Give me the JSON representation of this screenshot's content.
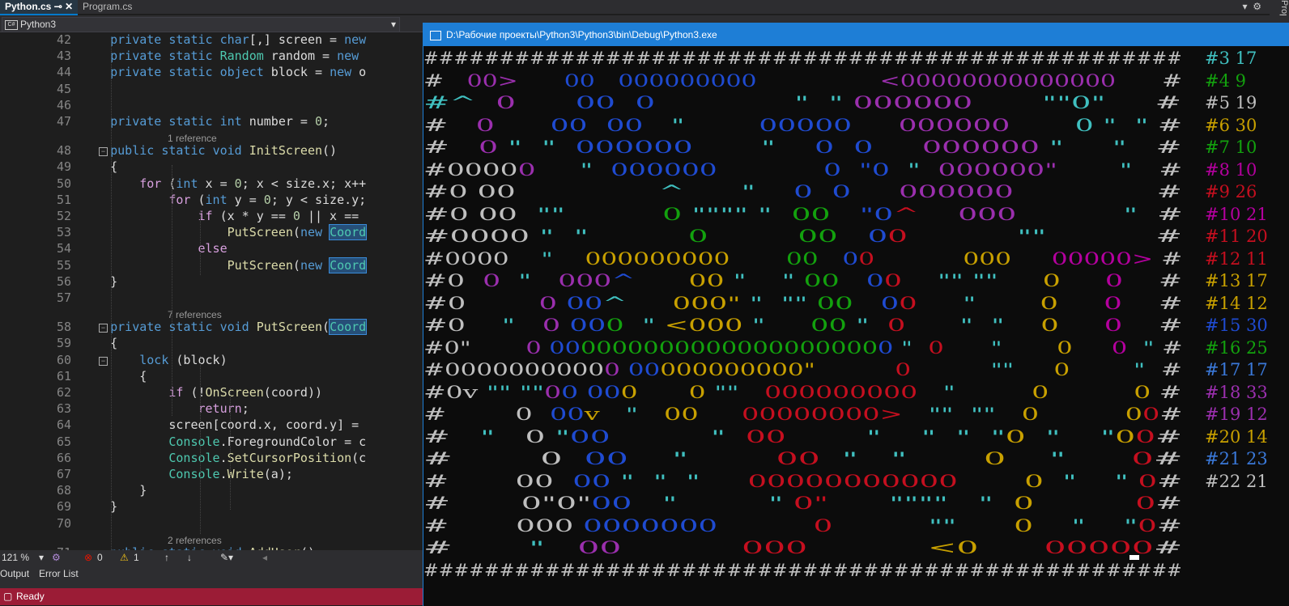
{
  "tabs": [
    {
      "label": "Python.cs",
      "active": true
    },
    {
      "label": "Program.cs",
      "active": false
    }
  ],
  "nav_combo": {
    "icon": "C#",
    "label": "Python3"
  },
  "side_panel": {
    "label": "Prope"
  },
  "editor_lines": [
    {
      "num": "42",
      "html": "    <span class=\"kw\">private static</span> <span class=\"kw\">char</span>[,] screen = <span class=\"kw\">new</span>"
    },
    {
      "num": "43",
      "html": "    <span class=\"kw\">private static</span> <span class=\"ty\">Random</span> random = <span class=\"kw\">new</span>"
    },
    {
      "num": "44",
      "html": "    <span class=\"kw\">private static</span> <span class=\"kw\">object</span> block = <span class=\"kw\">new</span> o"
    },
    {
      "num": "45",
      "html": ""
    },
    {
      "num": "46",
      "html": ""
    },
    {
      "num": "47",
      "html": "    <span class=\"kw\">private static</span> <span class=\"kw\">int</span> number = <span class=\"num\">0</span>;"
    },
    {
      "num": "48",
      "html": "    <span class=\"kw\">public static</span> <span class=\"kw\">void</span> <span class=\"mth\">InitScreen</span>()"
    },
    {
      "num": "49",
      "html": "    {"
    },
    {
      "num": "50",
      "html": "        <span class=\"ctl\">for</span> (<span class=\"kw\">int</span> x = <span class=\"num\">0</span>; x &lt; size.x; x++"
    },
    {
      "num": "51",
      "html": "            <span class=\"ctl\">for</span> (<span class=\"kw\">int</span> y = <span class=\"num\">0</span>; y &lt; size.y;"
    },
    {
      "num": "52",
      "html": "                <span class=\"ctl\">if</span> (x * y == <span class=\"num\">0</span> || x =="
    },
    {
      "num": "53",
      "html": "                    <span class=\"mth\">PutScreen</span>(<span class=\"kw\">new</span> <span class=\"hl\">Coord</span>"
    },
    {
      "num": "54",
      "html": "                <span class=\"ctl\">else</span>"
    },
    {
      "num": "55",
      "html": "                    <span class=\"mth\">PutScreen</span>(<span class=\"kw\">new</span> <span class=\"hl\">Coord</span>"
    },
    {
      "num": "56",
      "html": "    }"
    },
    {
      "num": "57",
      "html": ""
    },
    {
      "num": "58",
      "html": "    <span class=\"kw\">private static</span> <span class=\"kw\">void</span> <span class=\"mth\">PutScreen</span>(<span class=\"hl\">Coord</span>"
    },
    {
      "num": "59",
      "html": "    {"
    },
    {
      "num": "60",
      "html": "        <span class=\"kw\">lock</span> (block)"
    },
    {
      "num": "61",
      "html": "        {"
    },
    {
      "num": "62",
      "html": "            <span class=\"ctl\">if</span> (!<span class=\"mth\">OnScreen</span>(coord))"
    },
    {
      "num": "63",
      "html": "                <span class=\"ctl\">return</span>;"
    },
    {
      "num": "64",
      "html": "            screen[coord.x, coord.y] ="
    },
    {
      "num": "65",
      "html": "            <span class=\"ty\">Console</span>.ForegroundColor = c"
    },
    {
      "num": "66",
      "html": "            <span class=\"ty\">Console</span>.<span class=\"mth\">SetCursorPosition</span>(c"
    },
    {
      "num": "67",
      "html": "            <span class=\"ty\">Console</span>.<span class=\"mth\">Write</span>(a);"
    },
    {
      "num": "68",
      "html": "        }"
    },
    {
      "num": "69",
      "html": "    }"
    },
    {
      "num": "70",
      "html": ""
    },
    {
      "num": "71",
      "html": "    <span class=\"kw\">public static</span> <span class=\"kw\">void</span> <span class=\"mth\">AddUser</span>()"
    }
  ],
  "codelens": {
    "r1": "1 reference",
    "r7": "7 references",
    "r2": "2 references"
  },
  "zoom": {
    "level": "121 %",
    "errors": "0",
    "warnings": "1"
  },
  "bottom_tabs": {
    "output": "Output",
    "errorlist": "Error List"
  },
  "status": {
    "text": "Ready"
  },
  "console": {
    "title": "D:\\Рабочие проекты\\Python3\\Python3\\bin\\Debug\\Python3.exe"
  },
  "palette": {
    "p": "#9b2fae",
    "b": "#1f4bd1",
    "c": "#40c0c0",
    "w": "#bfbfbf",
    "y": "#c8a000",
    "g": "#13a10e",
    "r": "#c50f1f",
    "m": "#b4009e",
    "o": "#d08000",
    "n": "#3a78d8",
    "k": "#0c0c0c"
  },
  "screen_rows": [
    "w:##################################################",
    "w:#   |p:00>|w:      |b:00   000000000|w:                |p:<00000000000000|w:      #",
    "c:#^|w: |p: 0|w:      |b:00  0|w:              |c:\"  \"|w: |p:000000|w:       |c:\"\"0\"|w:     #",
    "w:#   |p:0|w:      |b:00  00|w:   |c:\"|w:        |b:00000|w:     |p:000000|w:       |c:0 \"  \"|w: #",
    "w:#   |p:0|w: |c:\"  \"|w:  |b:000000|w:       |c:\"|w:    |b:0  0|w:     |p:000000|w: |c:\"|w:     |c:\"|w:   #",
    "w:#0000|p:0|w:     |c:\"|w:  |b:000000|w:            |b:0|w:  |b:\"0|w:  |c:\"|w:  |p:000000\"|w:       |c:\"|w:   #",
    "w:#0 00|w:               |c:^|w:      |c:\"|w:    |b:0|w:  |b:0|w:     |p:000000|w:               #",
    "w:#0 00|w:  |c:\"\"|w:          |g:0|w: |c:\"\"\"\" \"|w:  |g:00|w:   |b:\"0|r:^|w:    |p:000|w:           |c:\"|w:  #",
    "w:#0000|w: |c:\"|w:  |c:\"|w:          |g:0|w:         |g:00|w:   |b:0|r:0|w:           |c:\"\"|w:           #",
    "w:#0000|w:    |c:\"|w:    |y:000000000|w:       |g:00|w:   |b:0|r:0|w:           |y:000|w:     |m:00000>|w: #",
    "w:#0|w:  |p:0|w:  |c:\"|w:   |p:000|b:^|w:      |y:00|w: |c:\"|w:    |c:\"|w: |g:00|w:   |b:0|r:0|w:    |c:\"\" \"\"|w:     |y:0|w:     |m:0|w:    #",
    "w:#0|w:        |p:0 |b:00|c:^|w:     |y:000\"|w: |c:\"|w:  |c:\"\"|w: |g:00|w:   |b:0|r:0|w:     |c:\"|w:       |y:0|w:     |m:0|w:    #",
    "w:#0|w:    |c:\"|w:   |p:0 |b:00|g:0|w:  |c:\"|w: |y:<000|w: |c:\"|w:     |g:00|w: |c:\"|w:  |r:0|w:      |c:\"  \"|w:    |y:0|w:     |m:0|w:    #",
    "w:#0\"|w:       |p:0 |b:00|g:0000000000000000000|b:0|w: |c:\"|w:  |r:0|w:      |c:\"|w:       |y:0|w:     |m:0|w:  |c:\"|w: #",
    "w:#0000000000|p:0|w: |b:00|y:000000000\"|w:          |r:0|w:          |c:\"\"|w:     |y:0|w:        |c:\"|w:  #",
    "w:#0v|w: |c:\"\" \"\"|p:0|b:0|w: |b:00|y:0|w:      |y:0|w: |c:\"\"|w:   |r:000000000|w:   |c:\"|w:         |y:0|w:          |y:0|w: #",
    "w:#|w:        0|w:  |b:00|y:v|w:   |c:\"|w:   |y:00|w:     |r:00000000>|w:   |c:\"\"  \"\"|w:   |y:0|w:          |y:0|r:0|w:#",
    "w:#|w:   |c:\"|w:   0|w: |c:\"|b:00|w:          |c:\"|w:  |r:00|w:        |c:\"|w:    |c:\"  \"|w:  |c:\"|y:0|w:  |c:\"|w:    |c:\"|y:0|r:0|w:#",
    "w:#|w:        0|w:  |b:00|w:    |c:\"|w:        |r:00|w:  |c:\"|w:   |c:\"|w:       |y:0|w:    |c:\"|w:      |r:0|w:#",
    "w:#|w:       00|w:  |b:00|w: |c:\"  \"|w:  |c:\"|w:     |r:00000000000|w:       |y:0|w:  |c:\"|w:    |c:\"|w: |r:0|w:#",
    "w:#|w:       0\"0\"|b:00|w:   |c:\"|w:         |c:\"|w: |r:0\"|w:      |c:\"\"\"\"|w:   |c:\"|w:  |y:0|w:          |r:0|w:#",
    "w:#|w:       000|w: |b:0000000|w:          |r:0|w:          |c:\"\"|w:      |y:0|w:    |c:\"|w:    |c:\"|r:0|w:#",
    "w:#|w:       |c:\"|w:   |p:00|w:           |r:000|w:           |y:<0|w:      |r:00000|w:#",
    "w:##################################################"
  ],
  "sidebar_rows": [
    {
      "label": "#3 17",
      "color": "#40c0c0"
    },
    {
      "label": "#4 9",
      "color": "#13a10e"
    },
    {
      "label": "#5 19",
      "color": "#bfbfbf"
    },
    {
      "label": "#6 30",
      "color": "#c8a000"
    },
    {
      "label": "#7 10",
      "color": "#13a10e"
    },
    {
      "label": "#8 10",
      "color": "#b4009e"
    },
    {
      "label": "#9 26",
      "color": "#c50f1f"
    },
    {
      "label": "#10 21",
      "color": "#b4009e"
    },
    {
      "label": "#11 20",
      "color": "#c50f1f"
    },
    {
      "label": "#12 11",
      "color": "#c50f1f"
    },
    {
      "label": "#13 17",
      "color": "#c8a000"
    },
    {
      "label": "#14 12",
      "color": "#c8a000"
    },
    {
      "label": "#15 30",
      "color": "#1f4bd1"
    },
    {
      "label": "#16 25",
      "color": "#13a10e"
    },
    {
      "label": "#17 17",
      "color": "#3a78d8"
    },
    {
      "label": "#18 33",
      "color": "#9b2fae"
    },
    {
      "label": "#19 12",
      "color": "#9b2fae"
    },
    {
      "label": "#20 14",
      "color": "#c8a000"
    },
    {
      "label": "#21 23",
      "color": "#3a78d8"
    },
    {
      "label": "#22 21",
      "color": "#bfbfbf"
    }
  ]
}
